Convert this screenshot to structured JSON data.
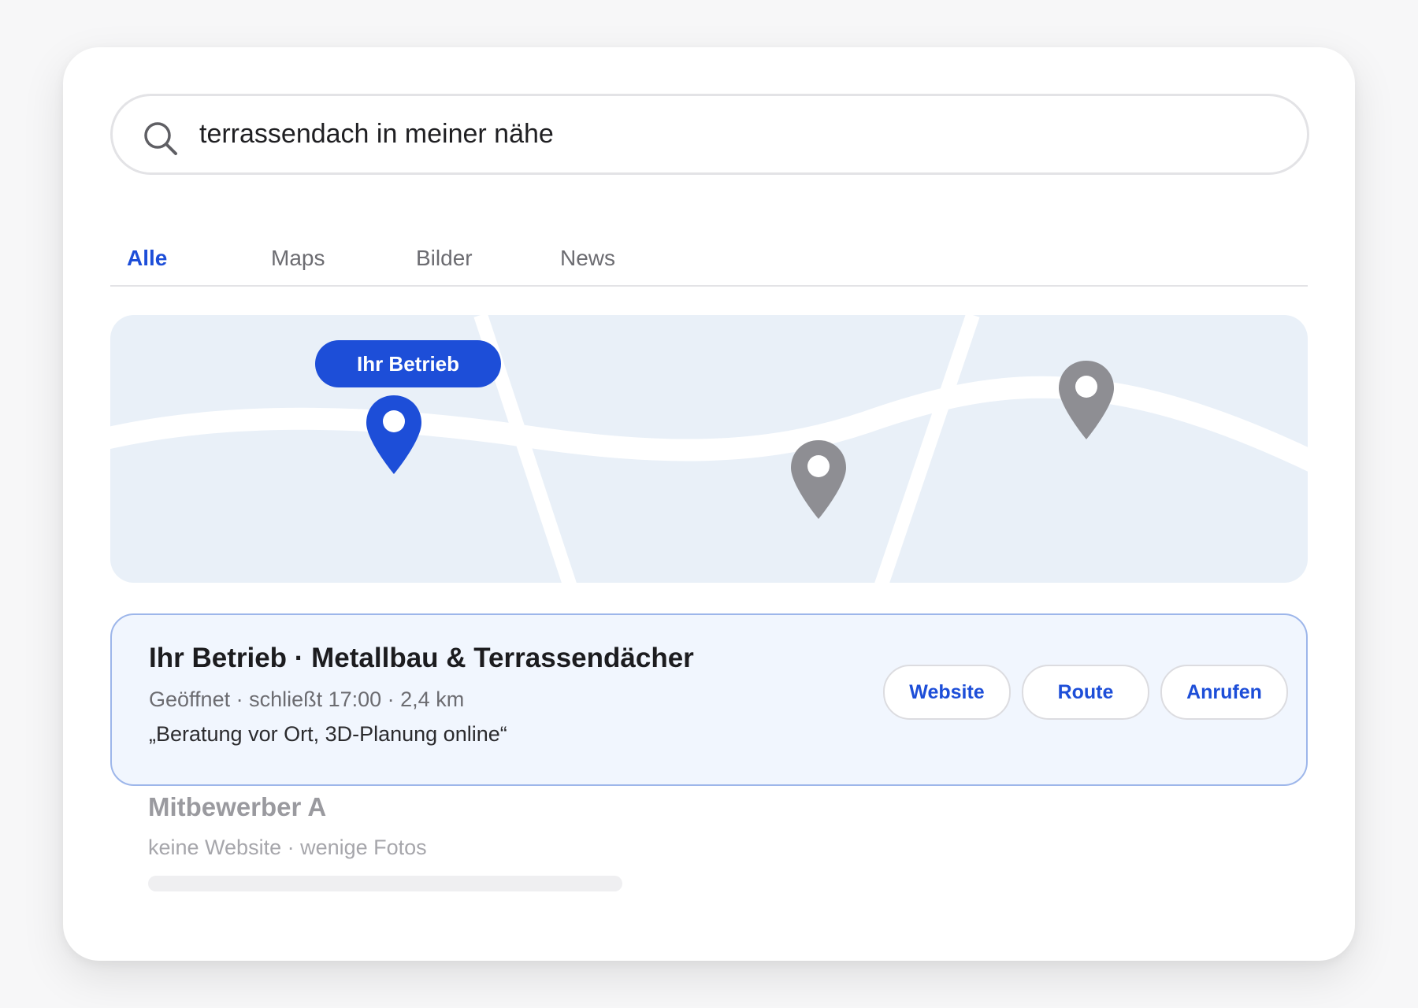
{
  "search": {
    "query": "terrassendach in meiner nähe",
    "icon": "search-icon"
  },
  "tabs": [
    {
      "label": "Alle",
      "active": true
    },
    {
      "label": "Maps",
      "active": false
    },
    {
      "label": "Bilder",
      "active": false
    },
    {
      "label": "News",
      "active": false
    }
  ],
  "map": {
    "badge_label": "Ihr Betrieb",
    "colors": {
      "background": "#e9f0f8",
      "road": "#ffffff",
      "highlight_pin": "#1d4ed8",
      "other_pin": "#8e8e93"
    }
  },
  "listing": {
    "title": "Ihr Betrieb · Metallbau & Terrassendächer",
    "meta": "Geöffnet · schließt 17:00 · 2,4 km",
    "quote": "„Beratung vor Ort, 3D-Planung online“",
    "buttons": {
      "website": "Website",
      "route": "Route",
      "call": "Anrufen"
    }
  },
  "competitor": {
    "title": "Mitbewerber A",
    "meta": "keine Website · wenige Fotos"
  },
  "colors": {
    "accent": "#1d4ed8",
    "card_border": "#9db6ea",
    "card_background": "#f1f6fe"
  }
}
